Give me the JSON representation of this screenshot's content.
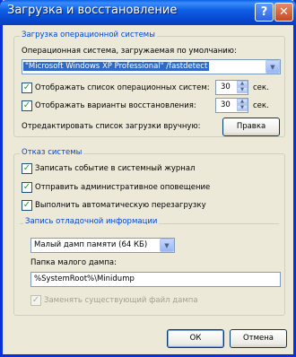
{
  "window": {
    "title": "Загрузка и восстановление",
    "help_symbol": "?",
    "close_symbol": "✕"
  },
  "os_group": {
    "legend": "Загрузка операционной системы",
    "default_os_label": "Операционная система, загружаемая по умолчанию:",
    "default_os_value": "\"Microsoft Windows XP Professional\" /fastdetect",
    "show_os_list": {
      "label": "Отображать список операционных систем:",
      "checked": true,
      "value": "30",
      "unit": "сек."
    },
    "show_recovery": {
      "label": "Отображать варианты восстановления:",
      "checked": true,
      "value": "30",
      "unit": "сек."
    },
    "edit_manual_label": "Отредактировать список загрузки вручную:",
    "edit_button": "Правка"
  },
  "failure_group": {
    "legend": "Отказ системы",
    "write_event": {
      "label": "Записать событие в системный журнал",
      "checked": true
    },
    "send_alert": {
      "label": "Отправить административное оповещение",
      "checked": true
    },
    "auto_restart": {
      "label": "Выполнить автоматическую перезагрузку",
      "checked": true
    },
    "debug_group": {
      "legend": "Запись отладочной информации",
      "dump_type": "Малый дамп памяти (64 КБ)",
      "dump_folder_label": "Папка малого дампа:",
      "dump_folder_value": "%SystemRoot%\\Minidump",
      "overwrite": {
        "label": "Заменять существующий файл дампа",
        "checked": true
      }
    }
  },
  "buttons": {
    "ok": "ОК",
    "cancel": "Отмена"
  }
}
